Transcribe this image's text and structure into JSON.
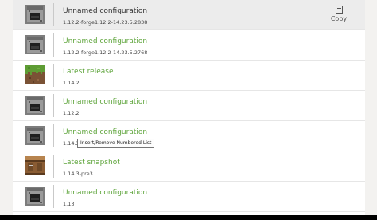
{
  "rows": [
    {
      "name": "Unnamed configuration",
      "version": "1.12.2-forge1.12.2-14.23.5.2838",
      "icon": "furnace-icon",
      "selected": true
    },
    {
      "name": "Unnamed configuration",
      "version": "1.12.2-forge1.12.2-14.23.5.2768",
      "icon": "furnace-icon",
      "selected": false
    },
    {
      "name": "Latest release",
      "version": "1.14.2",
      "icon": "grass-block-icon",
      "selected": false
    },
    {
      "name": "Unnamed configuration",
      "version": "1.12.2",
      "icon": "furnace-icon",
      "selected": false
    },
    {
      "name": "Unnamed configuration",
      "version": "1.14.3",
      "icon": "furnace-icon",
      "selected": false
    },
    {
      "name": "Latest snapshot",
      "version": "1.14.3-pre3",
      "icon": "crafting-table-icon",
      "selected": false
    },
    {
      "name": "Unnamed configuration",
      "version": "1.13",
      "icon": "furnace-icon",
      "selected": false
    }
  ],
  "copy_button": {
    "label": "Copy",
    "icon": "copy-icon"
  },
  "tooltip": {
    "text": "Insert/Remove Numbered List"
  },
  "colors": {
    "accent_green": "#5fa53c",
    "selected_row": "#ececec"
  }
}
